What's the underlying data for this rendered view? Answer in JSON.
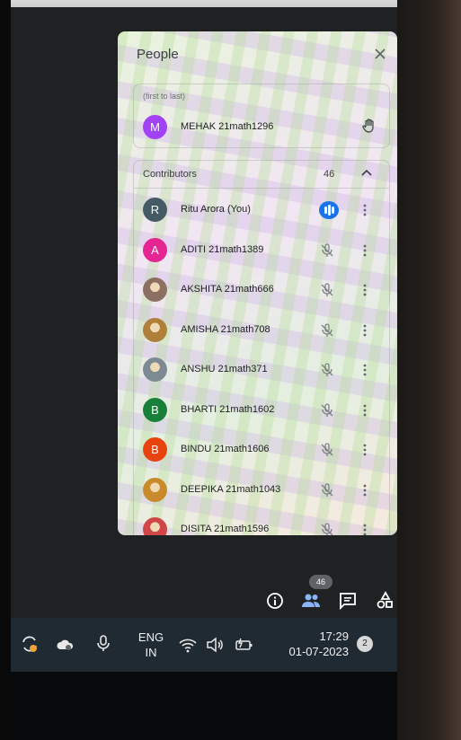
{
  "panel": {
    "title": "People",
    "raised_hands": {
      "caption": "(first to last)",
      "person": {
        "initial": "M",
        "name": "MEHAK 21math1296",
        "color": "#a142f4"
      }
    },
    "contributors": {
      "label": "Contributors",
      "count": "46",
      "people": [
        {
          "initial": "R",
          "name": "Ritu Arora (You)",
          "color": "#455a64",
          "status": "speaking"
        },
        {
          "initial": "A",
          "name": "ADITI 21math1389",
          "color": "#e52592",
          "status": "muted"
        },
        {
          "initial": "",
          "name": "AKSHITA 21math666",
          "color": "#8d6e63",
          "status": "muted",
          "photo": true
        },
        {
          "initial": "",
          "name": "AMISHA 21math708",
          "color": "#b0803a",
          "status": "muted",
          "photo": true
        },
        {
          "initial": "",
          "name": "ANSHU 21math371",
          "color": "#7d8a94",
          "status": "muted",
          "photo": true
        },
        {
          "initial": "B",
          "name": "BHARTI 21math1602",
          "color": "#188038",
          "status": "muted"
        },
        {
          "initial": "B",
          "name": "BINDU 21math1606",
          "color": "#e8430f",
          "status": "muted"
        },
        {
          "initial": "",
          "name": "DEEPIKA 21math1043",
          "color": "#c98a2b",
          "status": "muted",
          "photo": true
        },
        {
          "initial": "",
          "name": "DISITA 21math1596",
          "color": "#d04545",
          "status": "muted",
          "photo": true
        }
      ]
    }
  },
  "meeting_controls": {
    "people_badge": "46",
    "icons": [
      "info-icon",
      "people-icon",
      "chat-icon",
      "activities-icon"
    ]
  },
  "taskbar": {
    "language": {
      "line1": "ENG",
      "line2": "IN"
    },
    "time": "17:29",
    "date": "01-07-2023",
    "notifications": "2"
  }
}
